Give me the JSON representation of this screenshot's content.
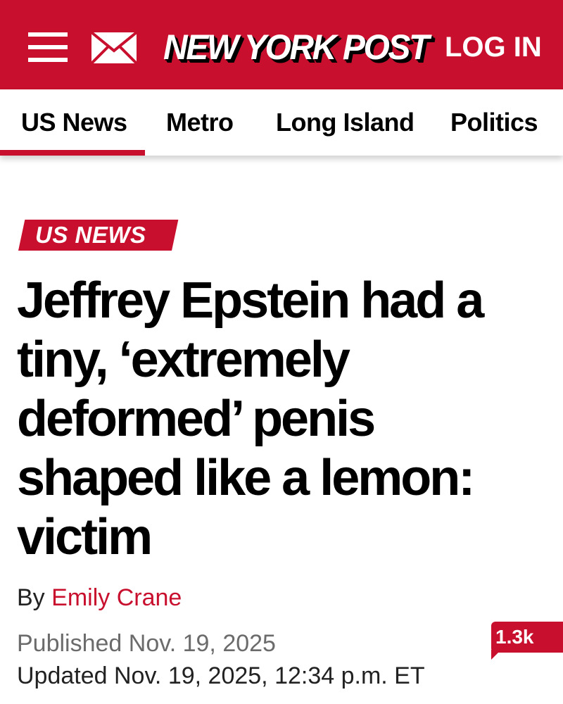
{
  "header": {
    "logo_text": "NEW YORK POST",
    "login_label": "LOG IN",
    "menu_icon": "hamburger-menu-icon",
    "mail_icon": "envelope-icon",
    "background_color": "#c8102e"
  },
  "nav": {
    "items": [
      {
        "label": "US News",
        "active": true
      },
      {
        "label": "Metro",
        "active": false
      },
      {
        "label": "Long Island",
        "active": false
      },
      {
        "label": "Politics",
        "active": false
      }
    ]
  },
  "article": {
    "section": "US NEWS",
    "headline": "Jeffrey Epstein had a tiny, ‘extremely deformed’ penis shaped like a lemon: victim",
    "byline_prefix": "By",
    "author": "Emily Crane",
    "published": "Published Nov. 19, 2025",
    "updated": "Updated Nov. 19, 2025, 12:34 p.m. ET",
    "comment_count": "1.3k",
    "comment_icon": "comment-bubble-icon"
  },
  "colors": {
    "accent": "#c8102e",
    "text": "#000000",
    "muted": "#6b6b6b"
  }
}
